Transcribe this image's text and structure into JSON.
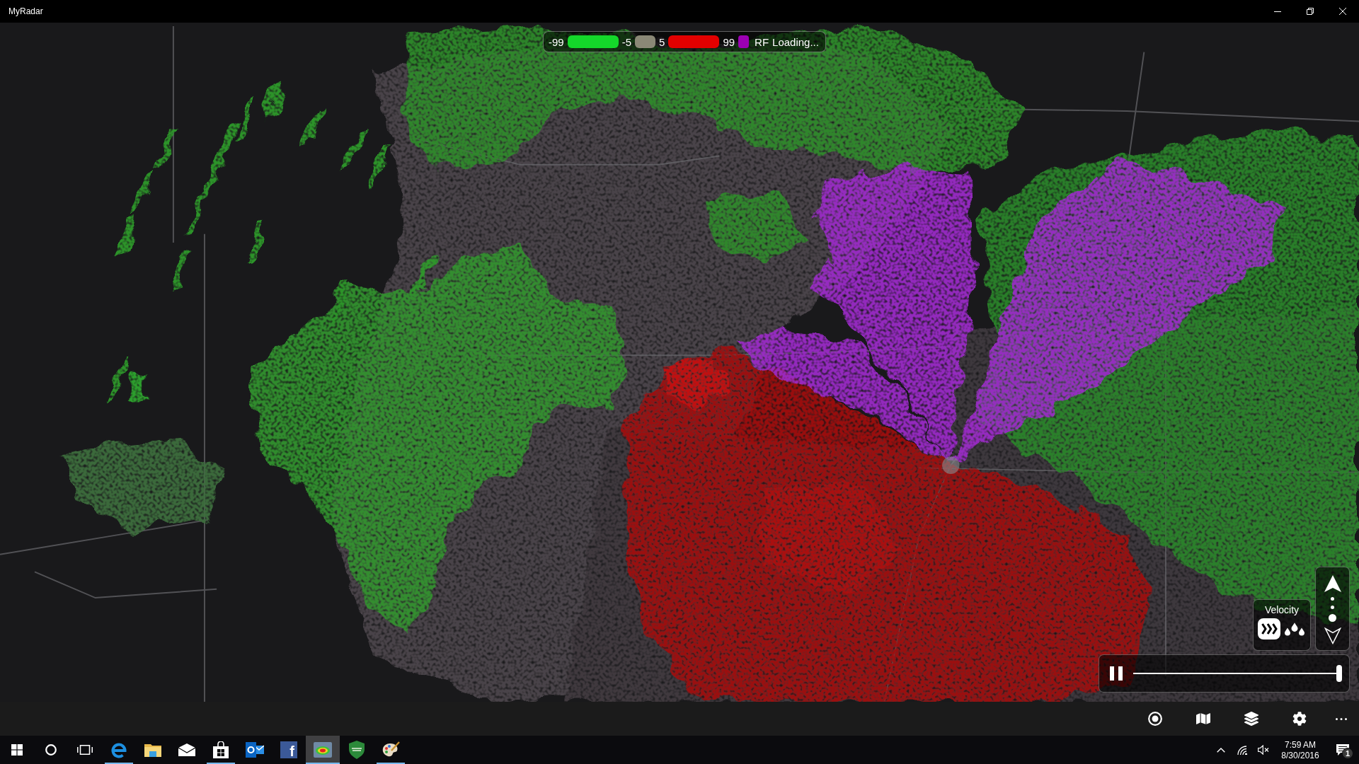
{
  "window": {
    "title": "MyRadar"
  },
  "legend": {
    "scale": [
      {
        "kind": "bar",
        "label": "-99",
        "color": "#14d82a"
      },
      {
        "kind": "short_bar",
        "label": "-5",
        "color": "#8a8876"
      },
      {
        "kind": "bar",
        "label": "5",
        "color": "#e20000"
      },
      {
        "kind": "swatch",
        "label": "99",
        "color": "#9c00b4"
      }
    ],
    "product": "RF",
    "status": "Loading..."
  },
  "layer_panel": {
    "title": "Velocity",
    "modes": [
      {
        "kind": "wind",
        "selected": true
      },
      {
        "kind": "rain",
        "selected": false
      }
    ]
  },
  "tilt_control": {
    "levels": [
      {
        "selected": false
      },
      {
        "selected": false
      },
      {
        "selected": true
      }
    ]
  },
  "playback": {
    "playing": true,
    "level": 1
  },
  "taskbar": {
    "apps": [
      {
        "kind": "browser",
        "running": true,
        "selected": false
      },
      {
        "kind": "folder",
        "running": false,
        "selected": false
      },
      {
        "kind": "mail",
        "running": false,
        "selected": false
      },
      {
        "kind": "store",
        "running": true,
        "selected": false
      },
      {
        "kind": "outlook",
        "running": false,
        "selected": false
      },
      {
        "kind": "facebook",
        "glyph": "f",
        "running": false,
        "selected": false
      },
      {
        "kind": "radar",
        "running": true,
        "selected": true
      },
      {
        "kind": "shield",
        "running": false,
        "selected": false
      },
      {
        "kind": "paint",
        "running": true,
        "selected": false
      }
    ]
  },
  "tray": {
    "volume_muted": true,
    "time": "7:59 AM",
    "date": "8/30/2016",
    "notification_count": "1"
  }
}
